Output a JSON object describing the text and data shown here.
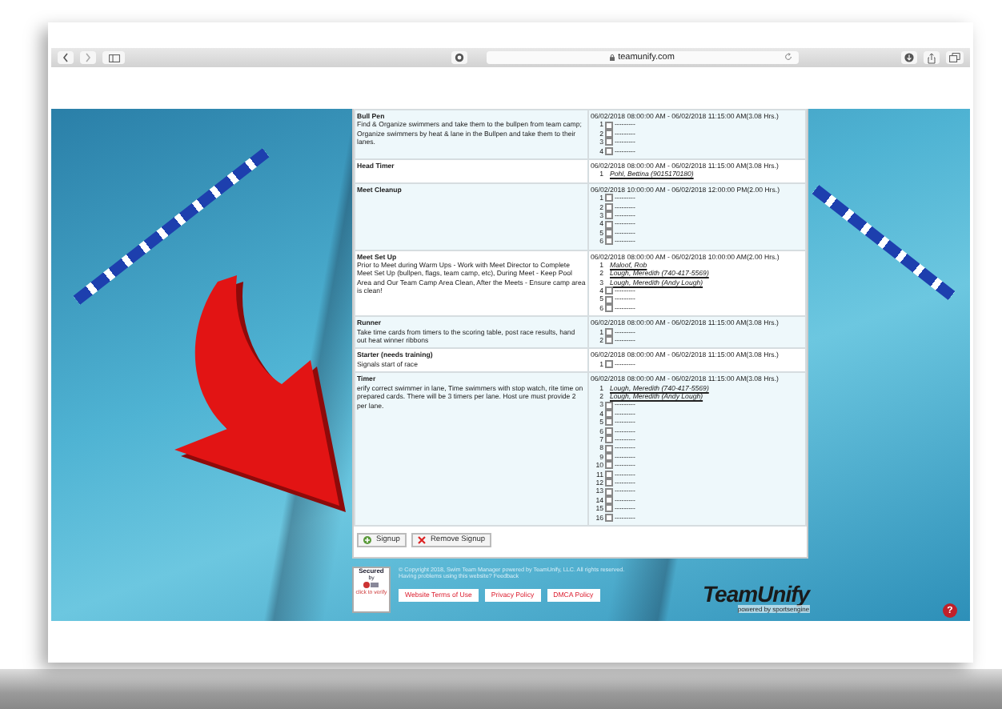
{
  "browser": {
    "url": "teamunify.com"
  },
  "roles": [
    {
      "name": "Bull Pen",
      "description": "Find & Organize swimmers and take them to the bullpen from team camp; Organize swimmers by heat & lane in the Bullpen and take them to their lanes.",
      "time": "06/02/2018 08:00:00 AM - 06/02/2018 11:15:00 AM(3.08 Hrs.)",
      "slots": [
        {
          "number": "1",
          "kind": "open",
          "text": "---------",
          "checked": false
        },
        {
          "number": "2",
          "kind": "open",
          "text": "---------",
          "checked": false
        },
        {
          "number": "3",
          "kind": "open",
          "text": "---------",
          "checked": false
        },
        {
          "number": "4",
          "kind": "open",
          "text": "---------",
          "checked": false
        }
      ]
    },
    {
      "name": "Head Timer",
      "time": "06/02/2018 08:00:00 AM - 06/02/2018 11:15:00 AM(3.08 Hrs.)",
      "slots": [
        {
          "number": "1",
          "kind": "taken",
          "text": "Pohl, Bettina (9015170180)"
        }
      ]
    },
    {
      "name": "Meet Cleanup",
      "time": "06/02/2018 10:00:00 AM - 06/02/2018 12:00:00 PM(2.00 Hrs.)",
      "slots": [
        {
          "number": "1",
          "kind": "open",
          "text": "---------",
          "checked": false
        },
        {
          "number": "2",
          "kind": "open",
          "text": "---------",
          "checked": false
        },
        {
          "number": "3",
          "kind": "open",
          "text": "---------",
          "checked": false
        },
        {
          "number": "4",
          "kind": "open",
          "text": "---------",
          "checked": false
        },
        {
          "number": "5",
          "kind": "open",
          "text": "---------",
          "checked": false
        },
        {
          "number": "6",
          "kind": "open",
          "text": "---------",
          "checked": false
        }
      ]
    },
    {
      "name": "Meet Set Up",
      "description": "Prior to Meet during Warm Ups - Work with Meet Director to Complete Meet Set Up (bullpen, flags, team camp, etc), During Meet - Keep Pool Area and Our Team Camp Area Clean, After the Meets - Ensure camp area is clean!",
      "time": "06/02/2018 08:00:00 AM - 06/02/2018 10:00:00 AM(2.00 Hrs.)",
      "slots": [
        {
          "number": "1",
          "kind": "taken",
          "text": "Maloof, Rob"
        },
        {
          "number": "2",
          "kind": "taken",
          "text": "Lough, Meredith (740-417-5569)"
        },
        {
          "number": "3",
          "kind": "taken",
          "text": "Lough, Meredith (Andy Lough)"
        },
        {
          "number": "4",
          "kind": "open",
          "text": "---------",
          "checked": false
        },
        {
          "number": "5",
          "kind": "open",
          "text": "---------",
          "checked": false
        },
        {
          "number": "6",
          "kind": "open",
          "text": "---------",
          "checked": false
        }
      ]
    },
    {
      "name": "Runner",
      "description": "Take time cards from timers to the scoring table, post race results, hand out heat winner ribbons",
      "time": "06/02/2018 08:00:00 AM - 06/02/2018 11:15:00 AM(3.08 Hrs.)",
      "slots": [
        {
          "number": "1",
          "kind": "open",
          "text": "---------",
          "checked": false
        },
        {
          "number": "2",
          "kind": "open",
          "text": "---------",
          "checked": false
        }
      ]
    },
    {
      "name": "Starter (needs training)",
      "description": "Signals start of race",
      "time": "06/02/2018 08:00:00 AM - 06/02/2018 11:15:00 AM(3.08 Hrs.)",
      "slots": [
        {
          "number": "1",
          "kind": "open",
          "text": "---------",
          "checked": false
        }
      ]
    },
    {
      "name": "Timer",
      "description": "erify correct swimmer in lane, Time swimmers with stop watch, rite time on prepared cards. There will be 3 timers per lane. Host ure must provide 2 per lane.",
      "time": "06/02/2018 08:00:00 AM - 06/02/2018 11:15:00 AM(3.08 Hrs.)",
      "slots": [
        {
          "number": "1",
          "kind": "taken",
          "text": "Lough, Meredith (740-417-5569)"
        },
        {
          "number": "2",
          "kind": "taken",
          "text": "Lough, Meredith (Andy Lough)"
        },
        {
          "number": "3",
          "kind": "open",
          "text": "---------",
          "checked": false
        },
        {
          "number": "4",
          "kind": "open",
          "text": "---------",
          "checked": false
        },
        {
          "number": "5",
          "kind": "open",
          "text": "---------",
          "checked": false
        },
        {
          "number": "6",
          "kind": "open",
          "text": "---------",
          "checked": false
        },
        {
          "number": "7",
          "kind": "open",
          "text": "---------",
          "checked": false
        },
        {
          "number": "8",
          "kind": "open",
          "text": "---------",
          "checked": false
        },
        {
          "number": "9",
          "kind": "open",
          "text": "---------",
          "checked": false
        },
        {
          "number": "10",
          "kind": "open",
          "text": "---------",
          "checked": false
        },
        {
          "number": "11",
          "kind": "open",
          "text": "---------",
          "checked": false
        },
        {
          "number": "12",
          "kind": "open",
          "text": "---------",
          "checked": false
        },
        {
          "number": "13",
          "kind": "open",
          "text": "---------",
          "checked": false
        },
        {
          "number": "14",
          "kind": "open",
          "text": "---------",
          "checked": false
        },
        {
          "number": "15",
          "kind": "open",
          "text": "---------",
          "checked": false
        },
        {
          "number": "16",
          "kind": "open",
          "text": "---------",
          "checked": false
        }
      ]
    }
  ],
  "buttons": [
    {
      "label": "Signup",
      "kind": "add"
    },
    {
      "label": "Remove Signup",
      "kind": "remove"
    }
  ],
  "footer": {
    "badge": {
      "title": "Secured",
      "by": "by",
      "verify": "click to verify"
    },
    "copyright": "© Copyright 2018, Swim Team Manager powered by TeamUnify, LLC. All rights reserved.",
    "help_line": "Having problems using this website? Feedback",
    "links": [
      "Website Terms of Use",
      "Privacy Policy",
      "DMCA Policy"
    ],
    "logo": {
      "name": "TeamUnify",
      "tagline": "powered by sportsengine"
    },
    "help_button": "?"
  }
}
